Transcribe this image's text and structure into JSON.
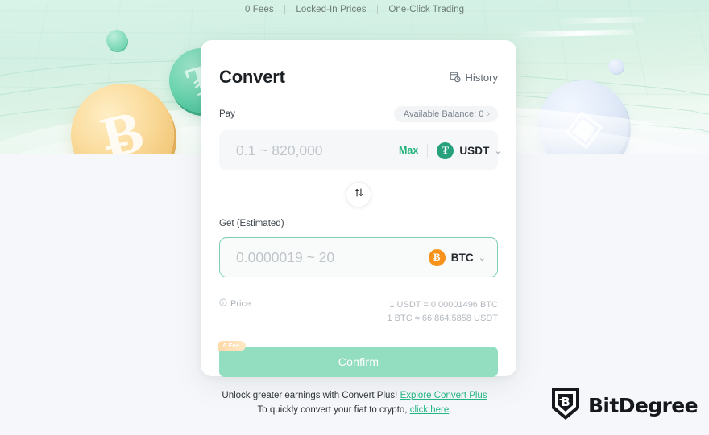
{
  "banner": {
    "features": [
      "0 Fees",
      "Locked-In Prices",
      "One-Click Trading"
    ],
    "separator": "|",
    "coins": {
      "bitcoin_glyph": "Ƀ",
      "tether_glyph": "₮",
      "ethereum_glyph": "◈"
    }
  },
  "card": {
    "title": "Convert",
    "history_label": "History",
    "pay": {
      "label": "Pay",
      "balance_label": "Available Balance: 0",
      "balance_chevron": "›",
      "input_placeholder": "0.1 ~ 820,000",
      "input_value": "",
      "max_label": "Max",
      "token": "USDT",
      "token_glyph": "₮",
      "token_color": "#26a17b",
      "chevron": "⌄"
    },
    "swap_label": "swap",
    "get": {
      "label": "Get (Estimated)",
      "input_placeholder": "0.0000019 ~ 20",
      "input_value": "",
      "token": "BTC",
      "token_glyph": "Ƀ",
      "token_color": "#f7931a",
      "chevron": "⌄"
    },
    "price": {
      "label": "Price:",
      "rate_a": "1 USDT = 0.00001496 BTC",
      "rate_b": "1 BTC ≈ 66,864.5858 USDT"
    },
    "confirm_label": "Confirm",
    "fee_badge": "0 Fee",
    "accent_color": "#93ddc0",
    "border_accent": "#7dcfae"
  },
  "footer": {
    "line1_text": "Unlock greater earnings with Convert Plus!",
    "line1_link": "Explore Convert Plus",
    "line2_text": "To quickly convert your fiat to crypto,",
    "line2_link": "click here",
    "line2_period": "."
  },
  "watermark": {
    "brand": "BitDegree",
    "mark": "B"
  }
}
